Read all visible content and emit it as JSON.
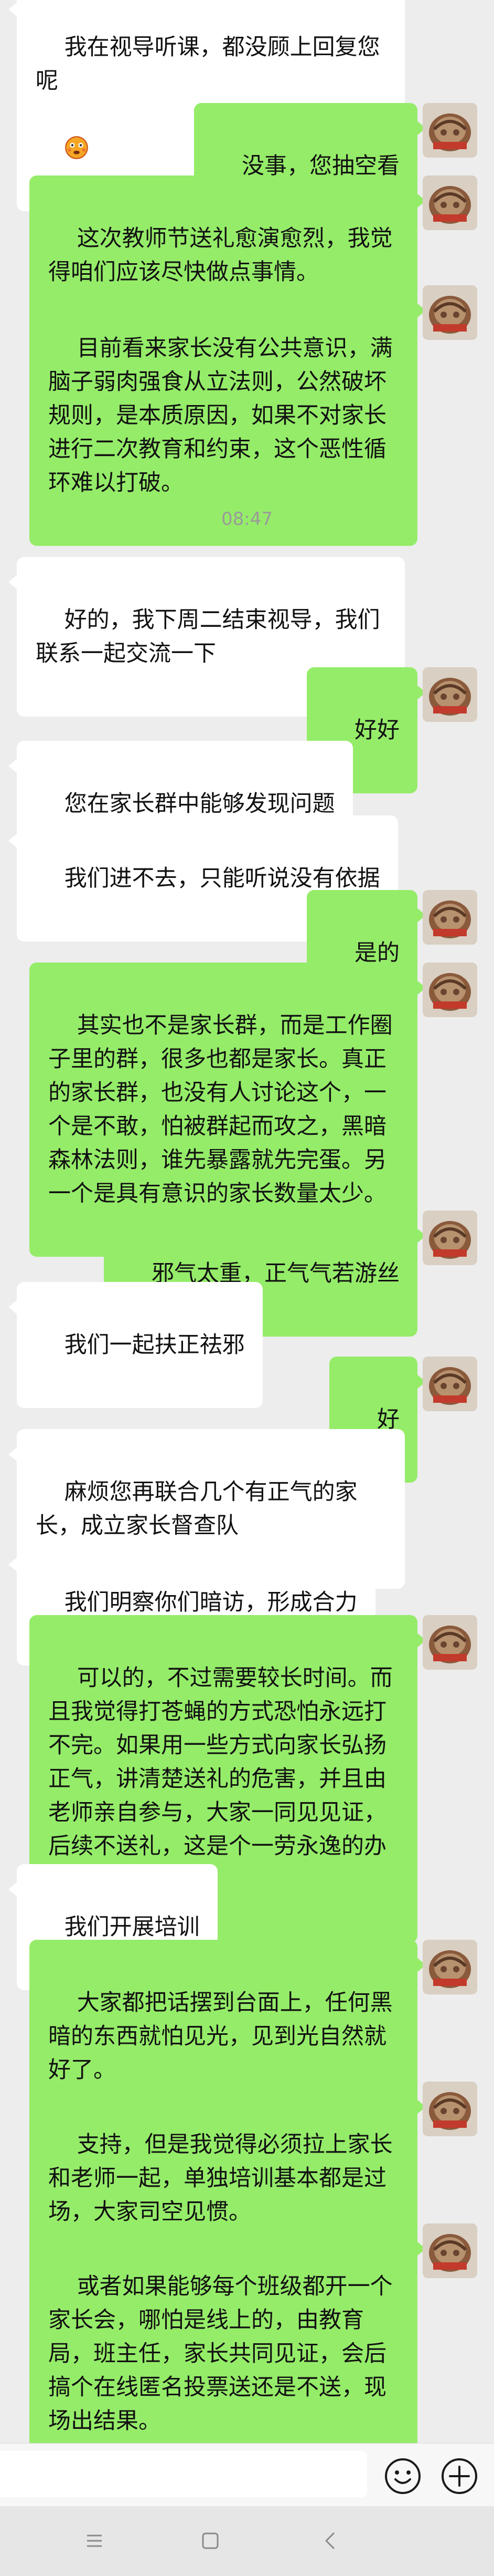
{
  "messages": [
    {
      "side": "in",
      "text": "我在视导听课，都没顾上回复您呢",
      "emoji": "flushed-face-emoji"
    },
    {
      "side": "out",
      "text": "没事，您抽空看"
    },
    {
      "side": "out",
      "text": "这次教师节送礼愈演愈烈，我觉得咱们应该尽快做点事情。"
    },
    {
      "side": "out",
      "text": "目前看来家长没有公共意识，满脑子弱肉强食从立法则，公然破坏规则，是本质原因，如果不对家长进行二次教育和约束，这个恶性循环难以打破。"
    },
    {
      "side": "time",
      "text": "08:47"
    },
    {
      "side": "in",
      "text": "好的，我下周二结束视导，我们联系一起交流一下"
    },
    {
      "side": "out",
      "text": "好好"
    },
    {
      "side": "in",
      "text": "您在家长群中能够发现问题"
    },
    {
      "side": "in",
      "text": "我们进不去，只能听说没有依据"
    },
    {
      "side": "out",
      "text": "是的"
    },
    {
      "side": "out",
      "text": "其实也不是家长群，而是工作圈子里的群，很多也都是家长。真正的家长群，也没有人讨论这个，一个是不敢，怕被群起而攻之，黑暗森林法则，谁先暴露就先完蛋。另一个是具有意识的家长数量太少。"
    },
    {
      "side": "out",
      "text": "邪气太重，正气气若游丝"
    },
    {
      "side": "in",
      "text": "我们一起扶正祛邪"
    },
    {
      "side": "out",
      "text": "好"
    },
    {
      "side": "in",
      "text": "麻烦您再联合几个有正气的家长，成立家长督查队"
    },
    {
      "side": "in",
      "text": "我们明察你们暗访，形成合力"
    },
    {
      "side": "out",
      "text": "可以的，不过需要较长时间。而且我觉得打苍蝇的方式恐怕永远打不完。如果用一些方式向家长弘扬正气，讲清楚送礼的危害，并且由老师亲自参与，大家一同见见证，后续不送礼，这是个一劳永逸的办法。"
    },
    {
      "side": "in",
      "text": "我们开展培训"
    },
    {
      "side": "out",
      "text": "大家都把话摆到台面上，任何黑暗的东西就怕见光，见到光自然就好了。"
    },
    {
      "side": "out",
      "text": "支持，但是我觉得必须拉上家长和老师一起，单独培训基本都是过场，大家司空见惯。"
    },
    {
      "side": "out",
      "text": "或者如果能够每个班级都开一个家长会，哪怕是线上的，由教育局，班主任，家长共同见证，会后搞个在线匿名投票送还是不送，现场出结果。"
    }
  ],
  "input": {
    "placeholder": ""
  },
  "icons": {
    "emoji": "emoji-icon",
    "add": "plus-icon",
    "menu": "menu-icon",
    "home": "home-icon",
    "back": "back-icon"
  },
  "colors": {
    "background": "#ededed",
    "outgoing_bubble": "#95ec69",
    "incoming_bubble": "#ffffff",
    "timestamp": "#9a9a9a"
  }
}
